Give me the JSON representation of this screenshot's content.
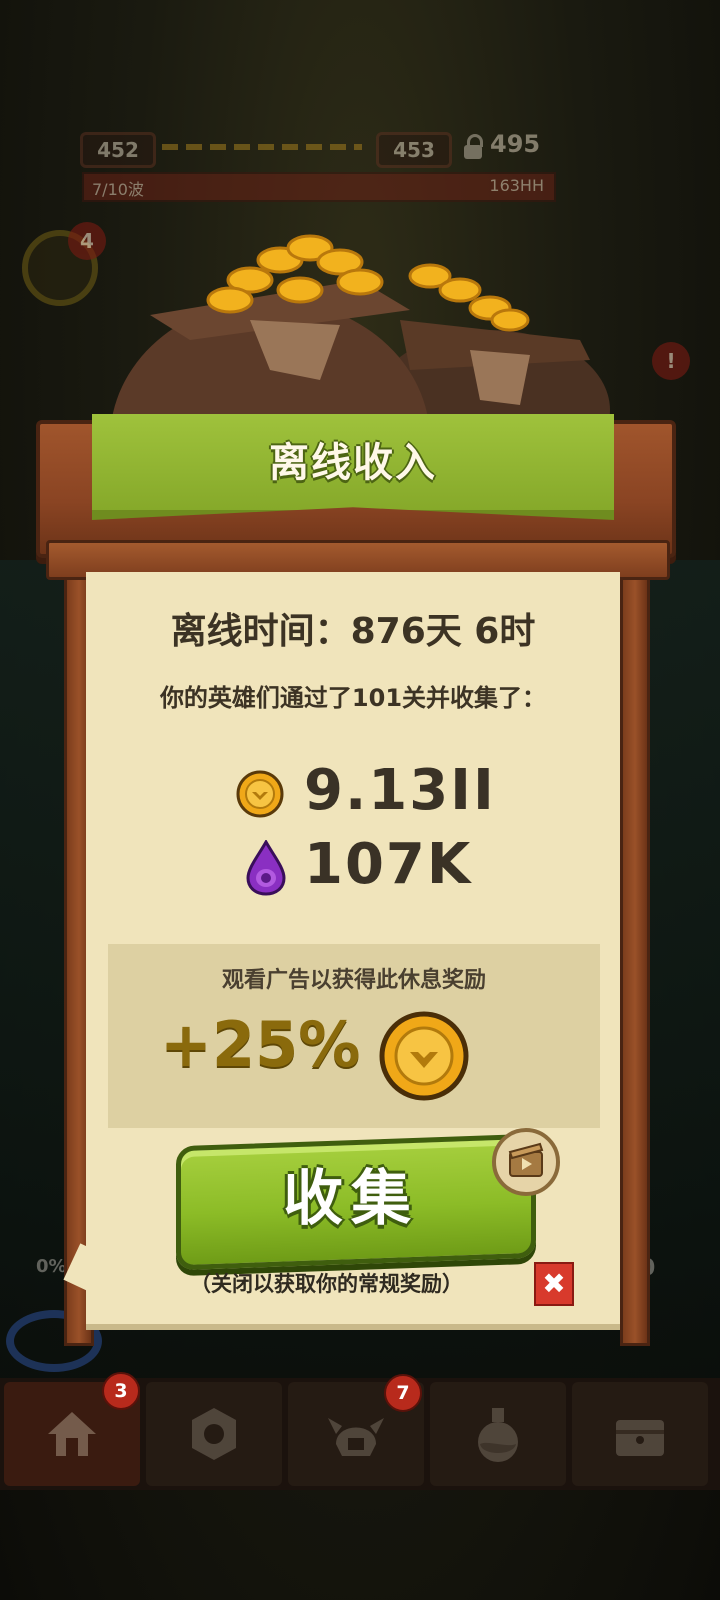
{
  "hud": {
    "current_level": "452",
    "next_level": "453",
    "locked_level": "495",
    "wave_text": "7/10波",
    "hp_text": "163HH"
  },
  "side": {
    "badge_left": "4",
    "badge_right": "!",
    "left_percent": "0%",
    "right_value": "0"
  },
  "dialog": {
    "title": "离线收入",
    "offline_time": "离线时间：876天 6时",
    "summary": "你的英雄们通过了101关并收集了：",
    "rewards": {
      "gold": "9.13II",
      "gems": "107K"
    },
    "ad_prompt": "观看广告以获得此休息奖励",
    "ad_bonus": "+25%",
    "collect_label": "收集",
    "close_hint": "（关闭以获取你的常规奖励）",
    "close_symbol": "✖"
  },
  "nav": {
    "items": [
      {
        "name": "home",
        "badge": "3"
      },
      {
        "name": "gear",
        "badge": ""
      },
      {
        "name": "heroes",
        "badge": "7"
      },
      {
        "name": "potion",
        "badge": ""
      },
      {
        "name": "chest",
        "badge": ""
      }
    ]
  },
  "colors": {
    "banner_green": "#9fc23c",
    "paper": "#f0e4bb",
    "wood": "#8a4423",
    "close_red": "#d83a2c"
  }
}
